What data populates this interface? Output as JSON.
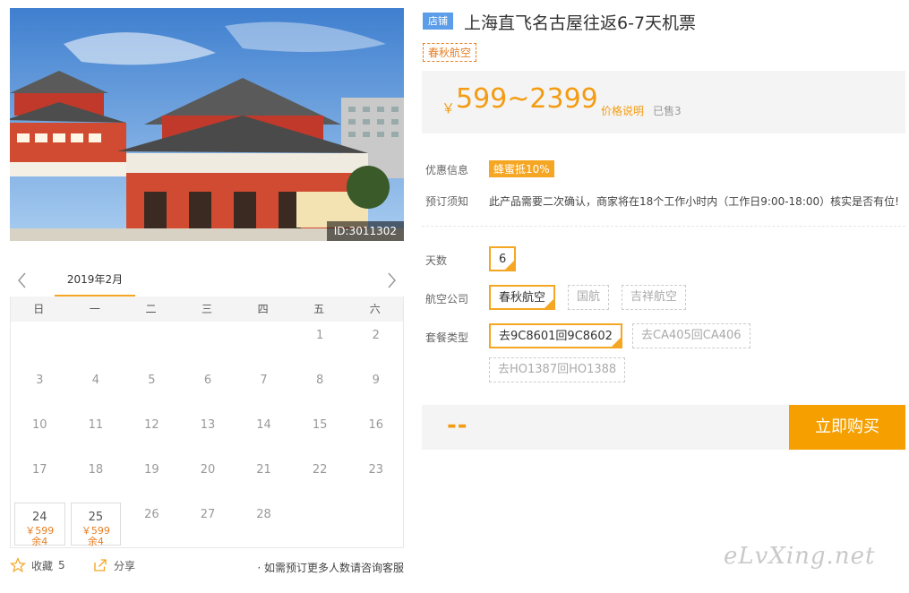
{
  "photo": {
    "id_label": "ID:3011302"
  },
  "calendar": {
    "month": "2019年2月",
    "weekdays": [
      "日",
      "一",
      "二",
      "三",
      "四",
      "五",
      "六"
    ],
    "days": [
      {
        "d": ""
      },
      {
        "d": ""
      },
      {
        "d": ""
      },
      {
        "d": ""
      },
      {
        "d": ""
      },
      {
        "d": "1"
      },
      {
        "d": "2"
      },
      {
        "d": "3"
      },
      {
        "d": "4"
      },
      {
        "d": "5"
      },
      {
        "d": "6"
      },
      {
        "d": "7"
      },
      {
        "d": "8"
      },
      {
        "d": "9"
      },
      {
        "d": "10"
      },
      {
        "d": "11"
      },
      {
        "d": "12"
      },
      {
        "d": "13"
      },
      {
        "d": "14"
      },
      {
        "d": "15"
      },
      {
        "d": "16"
      },
      {
        "d": "17"
      },
      {
        "d": "18"
      },
      {
        "d": "19"
      },
      {
        "d": "20"
      },
      {
        "d": "21"
      },
      {
        "d": "22"
      },
      {
        "d": "23"
      },
      {
        "d": "24",
        "price": "￥599",
        "remain": "余4"
      },
      {
        "d": "25",
        "price": "￥599",
        "remain": "余4"
      },
      {
        "d": "26"
      },
      {
        "d": "27"
      },
      {
        "d": "28"
      },
      {
        "d": ""
      },
      {
        "d": ""
      }
    ]
  },
  "bottom": {
    "favorite_label": "收藏",
    "favorite_count": "5",
    "share_label": "分享",
    "consult": "· 如需预订更多人数请咨询客服"
  },
  "product": {
    "store_tag": "店铺",
    "title": "上海直飞名古屋往返6-7天机票",
    "airline_tag": "春秋航空",
    "price_yen": "￥",
    "price_range": "599~2399",
    "price_note": "价格说明",
    "sold": "已售3",
    "promo_label": "优惠信息",
    "promo_tag": "蜂蜜抵10%",
    "notice_label": "预订须知",
    "notice_text": "此产品需要二次确认，商家将在18个工作小时内（工作日9:00-18:00）核实是否有位!"
  },
  "options": {
    "days_label": "天数",
    "days_value": "6",
    "airline_label": "航空公司",
    "airlines": [
      "春秋航空",
      "国航",
      "吉祥航空"
    ],
    "package_label": "套餐类型",
    "packages": [
      "去9C8601回9C8602",
      "去CA405回CA406",
      "去HO1387回HO1388"
    ]
  },
  "buy": {
    "total": "--",
    "button": "立即购买"
  },
  "watermark": "eLvXing.net",
  "colors": {
    "accent": "#f5a623",
    "price": "#f39c12",
    "store_tag": "#5b9de8"
  }
}
